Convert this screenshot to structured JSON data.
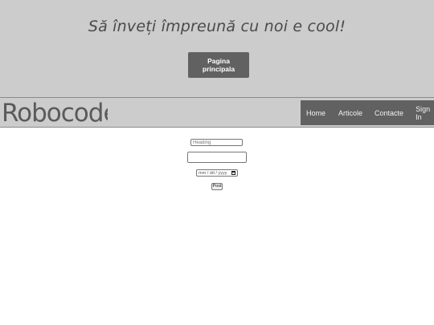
{
  "hero": {
    "title": "Să înveți împreună cu noi e cool!",
    "button_label": "Pagina principala"
  },
  "navbar": {
    "logo_text": "Robocode",
    "links": [
      {
        "label": "Home"
      },
      {
        "label": "Articole"
      },
      {
        "label": "Contacte"
      },
      {
        "label": "Sign In"
      }
    ]
  },
  "form": {
    "heading_placeholder": "Heading",
    "date_placeholder": "mm / dd / yyyy",
    "post_label": "Post"
  },
  "colors": {
    "header_bg": "#cccccc",
    "button_bg": "#616161",
    "nav_bg": "#616161",
    "text_light": "#ffffff"
  }
}
